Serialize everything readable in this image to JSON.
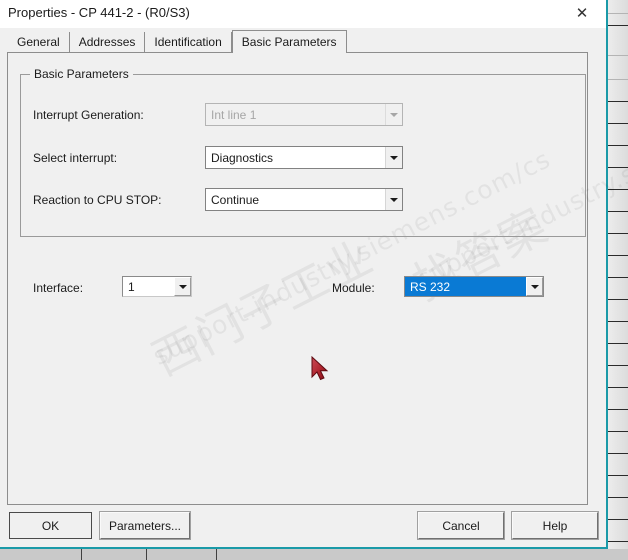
{
  "window": {
    "title": "Properties - CP 441-2 - (R0/S3)",
    "close_icon": "close-icon",
    "close_glyph": "✕"
  },
  "tabs": [
    {
      "label": "General",
      "active": false
    },
    {
      "label": "Addresses",
      "active": false
    },
    {
      "label": "Identification",
      "active": false
    },
    {
      "label": "Basic Parameters",
      "active": true
    }
  ],
  "groupbox": {
    "title": "Basic Parameters",
    "fields": [
      {
        "label": "Interrupt Generation:",
        "value": "Int line 1",
        "state": "disabled",
        "name": "interrupt-generation"
      },
      {
        "label": "Select interrupt:",
        "value": "Diagnostics",
        "state": "enabled",
        "name": "select-interrupt"
      },
      {
        "label": "Reaction to CPU STOP:",
        "value": "Continue",
        "state": "enabled",
        "name": "reaction-to-cpu-stop"
      }
    ]
  },
  "interface_row": {
    "interface_label": "Interface:",
    "interface_value": "1",
    "module_label": "Module:",
    "module_value": "RS 232",
    "module_highlight_color": "#0a7ad4"
  },
  "buttons": {
    "ok": "OK",
    "parameters": "Parameters...",
    "cancel": "Cancel",
    "help": "Help"
  },
  "watermarks": {
    "line1": "西门子工业",
    "line2": "support.industry.siemens.com/cs",
    "line3": "找答案"
  },
  "colors": {
    "dialog_border": "#1a9aa8",
    "dialog_face": "#f0f0f0",
    "selection_blue": "#0a7ad4"
  }
}
